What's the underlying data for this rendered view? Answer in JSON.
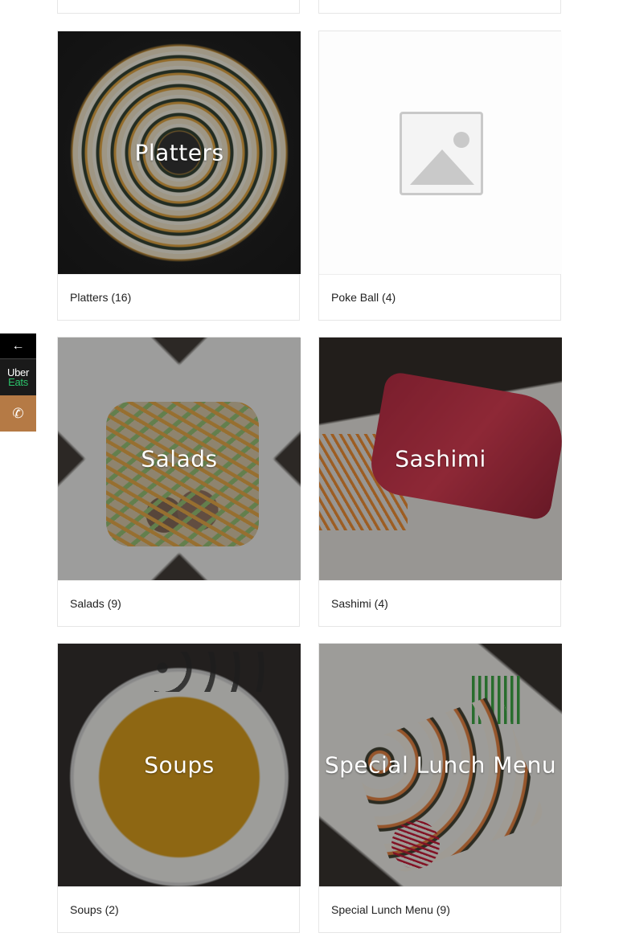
{
  "categories": [
    {
      "title": "Platters",
      "caption": "Platters (16)"
    },
    {
      "title": "",
      "caption": "Poke Ball (4)"
    },
    {
      "title": "Salads",
      "caption": "Salads (9)"
    },
    {
      "title": "Sashimi",
      "caption": "Sashimi (4)"
    },
    {
      "title": "Soups",
      "caption": "Soups (2)"
    },
    {
      "title": "Special Lunch Menu",
      "caption": "Special Lunch Menu (9)"
    }
  ],
  "side_buttons": {
    "back_glyph": "←",
    "uber_line1": "Uber",
    "uber_line2": "Eats",
    "phone_glyph": "✆"
  },
  "colors": {
    "phone_button": "#b57a45",
    "uber_green": "#2bc26a"
  }
}
